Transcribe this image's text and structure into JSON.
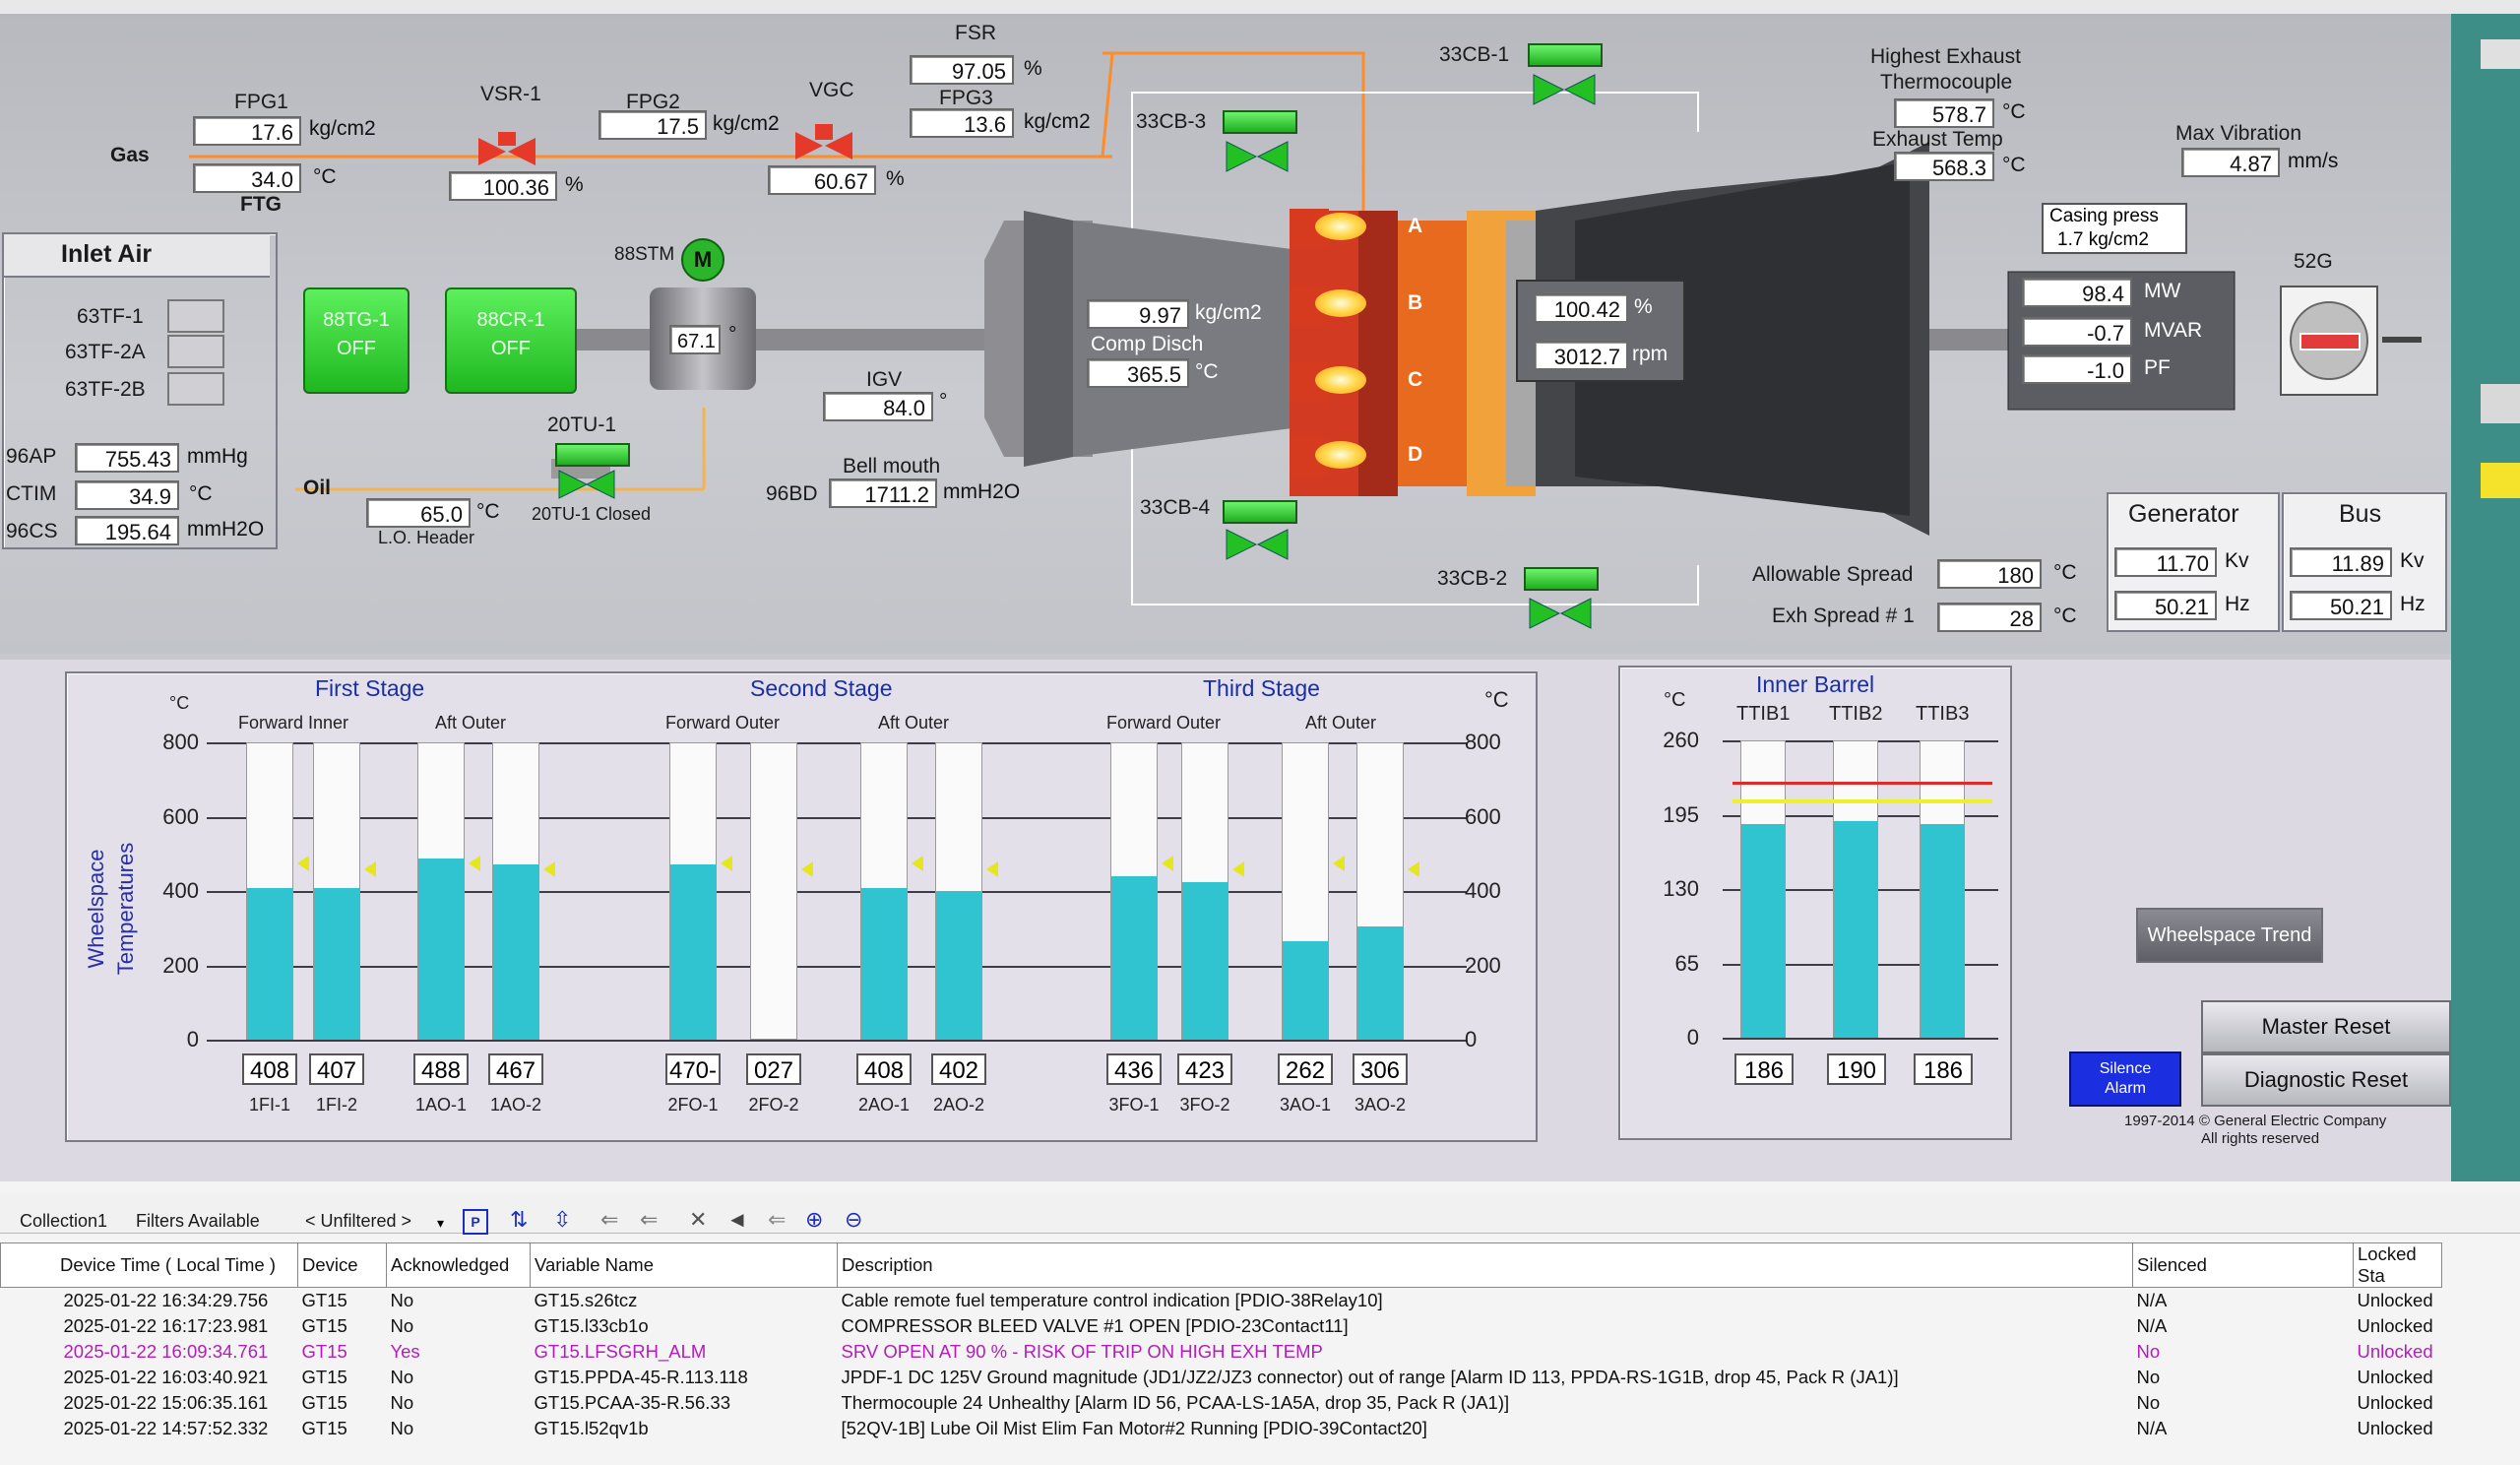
{
  "top": {
    "fuel": {
      "gas_label": "Gas",
      "fpg1_label": "FPG1",
      "fpg1_value": "17.6",
      "fpg1_unit": "kg/cm2",
      "ftg_value": "34.0",
      "ftg_unit": "°C",
      "ftg_label": "FTG",
      "vsr_label": "VSR-1",
      "vsr_value": "100.36",
      "vsr_unit": "%",
      "fpg2_label": "FPG2",
      "fpg2_value": "17.5",
      "fpg2_unit": "kg/cm2",
      "vgc_label": "VGC",
      "vgc_value": "60.67",
      "vgc_unit": "%",
      "fsr_label": "FSR",
      "fsr_value": "97.05",
      "fsr_unit": "%",
      "fpg3_label": "FPG3",
      "fpg3_value": "13.6",
      "fpg3_unit": "kg/cm2"
    },
    "inlet_air": {
      "title": "Inlet Air",
      "items": [
        {
          "label": "63TF-1",
          "value": ""
        },
        {
          "label": "63TF-2A",
          "value": ""
        },
        {
          "label": "63TF-2B",
          "value": ""
        }
      ],
      "ap_label": "96AP",
      "ap_value": "755.43",
      "ap_unit": "mmHg",
      "ctim_label": "CTIM",
      "ctim_value": "34.9",
      "ctim_unit": "°C",
      "cs_label": "96CS",
      "cs_value": "195.64",
      "cs_unit": "mmH2O"
    },
    "aux": {
      "tg_label": "88TG-1",
      "tg_state": "OFF",
      "cr_label": "88CR-1",
      "cr_state": "OFF",
      "stm_label": "88STM",
      "motor_glyph": "M",
      "gear_value": "67.1",
      "gear_unit": "°",
      "tu_label": "20TU-1",
      "tu_status": "20TU-1 Closed",
      "oil_label": "Oil",
      "lo_value": "65.0",
      "lo_unit": "°C",
      "lo_label": "L.O. Header"
    },
    "compressor": {
      "igv_label": "IGV",
      "igv_value": "84.0",
      "igv_unit": "°",
      "bell_label": "Bell mouth",
      "bd_label": "96BD",
      "bd_value": "1711.2",
      "bd_unit": "mmH2O",
      "cpd_value": "9.97",
      "cpd_unit": "kg/cm2",
      "cpd_label": "Comp Disch",
      "ctd_value": "365.5",
      "ctd_unit": "°C"
    },
    "combustors": [
      "A",
      "B",
      "C",
      "D"
    ],
    "bleeds": {
      "cb1": "33CB-1",
      "cb2": "33CB-2",
      "cb3": "33CB-3",
      "cb4": "33CB-4"
    },
    "turbine": {
      "speed_pct": "100.42",
      "speed_pct_unit": "%",
      "rpm": "3012.7",
      "rpm_unit": "rpm"
    },
    "exhaust": {
      "highest_label_1": "Highest Exhaust",
      "highest_label_2": "Thermocouple",
      "highest_value": "578.7",
      "highest_unit": "°C",
      "temp_label": "Exhaust Temp",
      "temp_value": "568.3",
      "temp_unit": "°C",
      "vib_label": "Max Vibration",
      "vib_value": "4.87",
      "vib_unit": "mm/s",
      "casing_label": "Casing press",
      "casing_value": "1.7  kg/cm2"
    },
    "generator": {
      "mw": "98.4",
      "mw_unit": "MW",
      "mvar": "-0.7",
      "mvar_unit": "MVAR",
      "pf": "-1.0",
      "pf_unit": "PF",
      "breaker_label": "52G",
      "gen_title": "Generator",
      "gen_kv": "11.70",
      "gen_hz": "50.21",
      "bus_title": "Bus",
      "bus_kv": "11.89",
      "bus_hz": "50.21",
      "kv_unit": "Kv",
      "hz_unit": "Hz"
    },
    "spread": {
      "allowable_label": "Allowable Spread",
      "allowable_value": "180",
      "allowable_unit": "°C",
      "exh_label": "Exh Spread # 1",
      "exh_value": "28",
      "exh_unit": "°C"
    }
  },
  "wheelspace": {
    "y_label_1": "Wheelspace",
    "y_label_2": "Temperatures",
    "unit": "°C",
    "ticks": [
      "800",
      "600",
      "400",
      "200",
      "0"
    ],
    "stages": [
      {
        "title": "First Stage",
        "groups": [
          "Forward Inner",
          "Aft Outer"
        ]
      },
      {
        "title": "Second Stage",
        "groups": [
          "Forward Outer",
          "Aft Outer"
        ]
      },
      {
        "title": "Third Stage",
        "groups": [
          "Forward Outer",
          "Aft Outer"
        ]
      }
    ],
    "bars": [
      {
        "name": "1FI-1",
        "value": "408"
      },
      {
        "name": "1FI-2",
        "value": "407"
      },
      {
        "name": "1AO-1",
        "value": "488"
      },
      {
        "name": "1AO-2",
        "value": "467"
      },
      {
        "name": "2FO-1",
        "value": "470-"
      },
      {
        "name": "2FO-2",
        "value": "027"
      },
      {
        "name": "2AO-1",
        "value": "408"
      },
      {
        "name": "2AO-2",
        "value": "402"
      },
      {
        "name": "3FO-1",
        "value": "436"
      },
      {
        "name": "3FO-2",
        "value": "423"
      },
      {
        "name": "3AO-1",
        "value": "262"
      },
      {
        "name": "3AO-2",
        "value": "306"
      }
    ],
    "fill_pct": [
      0.51,
      0.51,
      0.61,
      0.59,
      0.59,
      0.0,
      0.51,
      0.5,
      0.55,
      0.53,
      0.33,
      0.38
    ]
  },
  "inner_barrel": {
    "title": "Inner Barrel",
    "unit": "°C",
    "ticks": [
      "260",
      "195",
      "130",
      "65",
      "0"
    ],
    "bars": [
      {
        "name": "TTIB1",
        "value": "186"
      },
      {
        "name": "TTIB2",
        "value": "190"
      },
      {
        "name": "TTIB3",
        "value": "186"
      }
    ],
    "fill_pct": [
      0.72,
      0.73,
      0.72
    ]
  },
  "buttons": {
    "wheelspace_trend": "Wheelspace Trend",
    "master_reset": "Master Reset",
    "diagnostic_reset": "Diagnostic Reset",
    "silence_1": "Silence",
    "silence_2": "Alarm",
    "copyright_1": "1997-2014 © General Electric Company",
    "copyright_2": "All rights reserved"
  },
  "alarm_toolbar": {
    "collection": "Collection1",
    "filters": "Filters Available",
    "unfiltered": "< Unfiltered >"
  },
  "alarms": {
    "headers": [
      "Device Time ( Local Time )",
      "Device",
      "Acknowledged",
      "Variable Name",
      "Description",
      "Silenced",
      "Locked Sta"
    ],
    "rows": [
      [
        "2025-01-22 16:34:29.756",
        "GT15",
        "No",
        "GT15.s26tcz",
        "Cable remote fuel temperature control indication [PDIO-38Relay10]",
        "N/A",
        "Unlocked"
      ],
      [
        "2025-01-22 16:17:23.981",
        "GT15",
        "No",
        "GT15.l33cb1o",
        "COMPRESSOR BLEED VALVE #1 OPEN [PDIO-23Contact11]",
        "N/A",
        "Unlocked"
      ],
      [
        "2025-01-22 16:09:34.761",
        "GT15",
        "Yes",
        "GT15.LFSGRH_ALM",
        "SRV OPEN AT 90 % - RISK OF TRIP ON HIGH EXH TEMP",
        "No",
        "Unlocked"
      ],
      [
        "2025-01-22 16:03:40.921",
        "GT15",
        "No",
        "GT15.PPDA-45-R.113.118",
        "JPDF-1 DC 125V Ground magnitude (JD1/JZ2/JZ3 connector) out of range [Alarm ID 113, PPDA-RS-1G1B, drop 45, Pack R (JA1)]",
        "No",
        "Unlocked"
      ],
      [
        "2025-01-22 15:06:35.161",
        "GT15",
        "No",
        "GT15.PCAA-35-R.56.33",
        "Thermocouple 24 Unhealthy [Alarm ID 56, PCAA-LS-1A5A, drop 35, Pack R (JA1)]",
        "No",
        "Unlocked"
      ],
      [
        "2025-01-22 14:57:52.332",
        "GT15",
        "No",
        "GT15.l52qv1b",
        "[52QV-1B] Lube Oil Mist Elim Fan Motor#2 Running [PDIO-39Contact20]",
        "N/A",
        "Unlocked"
      ]
    ]
  },
  "colors": {
    "fill": "#2fc4cf",
    "valve_open": "#22c022",
    "valve_red": "#e53a2a",
    "fuel_line": "#ff8c2a",
    "ack_text": "#b21eb9"
  }
}
